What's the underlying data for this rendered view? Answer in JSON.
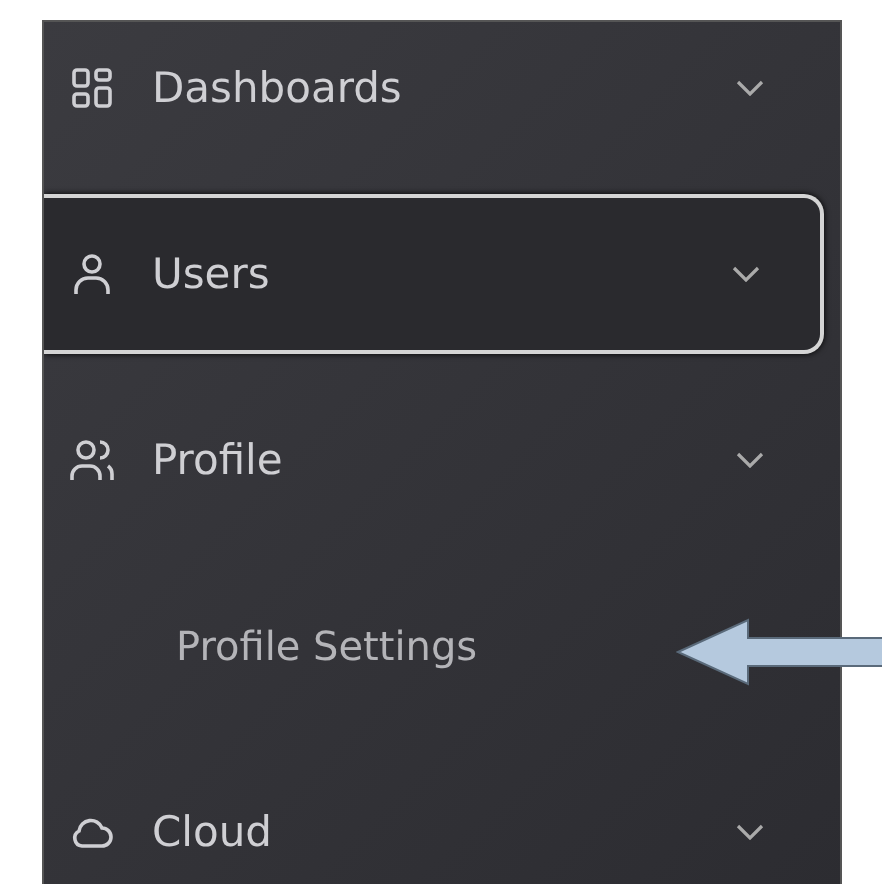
{
  "menu": [
    {
      "kind": "item",
      "label": "Dashboards",
      "selected": false
    },
    {
      "kind": "item",
      "label": "Users",
      "selected": true
    },
    {
      "kind": "item",
      "label": "Profile",
      "selected": false
    },
    {
      "kind": "subitem",
      "label": "Profile Settings",
      "selected": false
    },
    {
      "kind": "item",
      "label": "Cloud",
      "selected": false
    }
  ]
}
